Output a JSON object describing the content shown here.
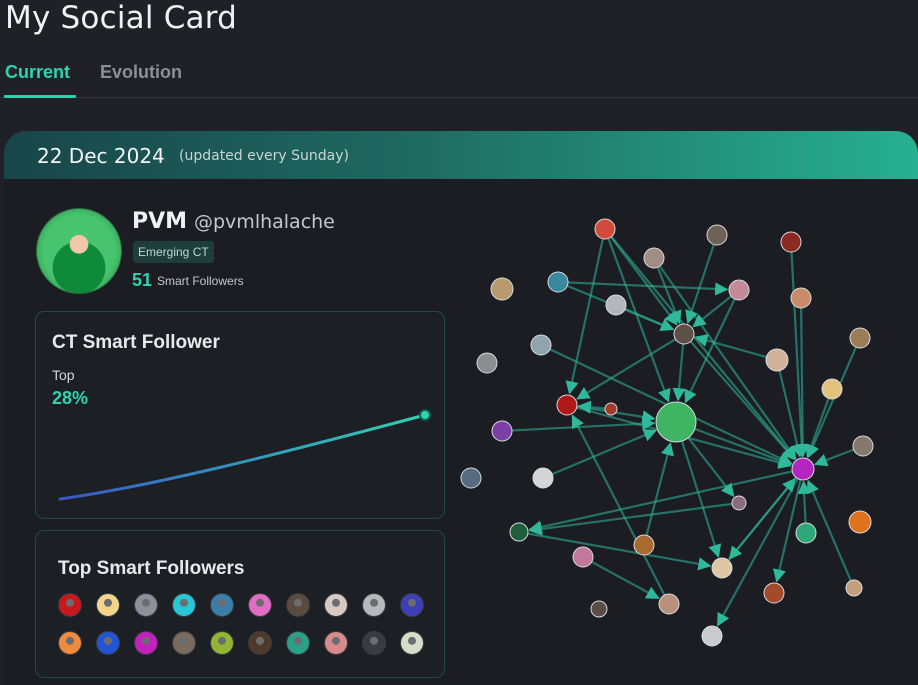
{
  "page": {
    "title": "My Social Card"
  },
  "tabs": [
    {
      "label": "Current",
      "active": true
    },
    {
      "label": "Evolution",
      "active": false
    }
  ],
  "card": {
    "date": "22 Dec 2024",
    "update_note": "(updated every Sunday)",
    "header_gradient": [
      "#18454a",
      "#27b091"
    ]
  },
  "profile": {
    "name": "PVM",
    "handle": "@pvmlhalache",
    "badge": "Emerging CT",
    "smart_followers_count": "51",
    "smart_followers_label": "Smart Followers"
  },
  "ct_panel": {
    "title": "CT Smart Follower",
    "top_label": "Top",
    "top_value": "28%",
    "trend_start_color": "#3a55c8",
    "trend_end_color": "#2fd3b0"
  },
  "top_followers": {
    "title": "Top Smart Followers",
    "avatars": [
      {
        "icon": "red-eye-avatar-icon",
        "color": "#c8181c"
      },
      {
        "icon": "blonde-avatar-icon",
        "color": "#f3d58a"
      },
      {
        "icon": "portrait-avatar-icon",
        "color": "#8d9098"
      },
      {
        "icon": "cyan-face-avatar-icon",
        "color": "#28c7d6"
      },
      {
        "icon": "blue-creature-avatar-icon",
        "color": "#3a7fa8"
      },
      {
        "icon": "pink-character-avatar-icon",
        "color": "#e26bc3"
      },
      {
        "icon": "dark-portrait-avatar-icon",
        "color": "#5b4a3e"
      },
      {
        "icon": "pale-face-avatar-icon",
        "color": "#d9c9c3"
      },
      {
        "icon": "grayscale-man-avatar-icon",
        "color": "#b7b9bc"
      },
      {
        "icon": "neon-avatar-icon",
        "color": "#3d3fb8"
      },
      {
        "icon": "orange-avatar-icon",
        "color": "#f08a3d"
      },
      {
        "icon": "blue-pixel-avatar-icon",
        "color": "#2254d6"
      },
      {
        "icon": "magenta-avatar-icon",
        "color": "#c51fc1"
      },
      {
        "icon": "bearded-man-avatar-icon",
        "color": "#7b6a5e"
      },
      {
        "icon": "green-alien-avatar-icon",
        "color": "#93b534"
      },
      {
        "icon": "dark-beard-avatar-icon",
        "color": "#4f3a2c"
      },
      {
        "icon": "teal-robot-avatar-icon",
        "color": "#2ba089"
      },
      {
        "icon": "pink-skull-avatar-icon",
        "color": "#d98a8a"
      },
      {
        "icon": "shadow-figure-avatar-icon",
        "color": "#383b44"
      },
      {
        "icon": "striped-avatar-icon",
        "color": "#d8dccb"
      }
    ]
  },
  "graph": {
    "nodes": [
      {
        "name": "graph-node-red-hat",
        "color": "#d24a3c"
      },
      {
        "name": "graph-node-portrait-a",
        "color": "#a08d84"
      },
      {
        "name": "graph-node-dark-man",
        "color": "#6e6258"
      },
      {
        "name": "graph-node-red-mask",
        "color": "#8b2a22"
      },
      {
        "name": "graph-node-tan-circle",
        "color": "#b89a6e"
      },
      {
        "name": "graph-node-blue-bear",
        "color": "#3a88a0"
      },
      {
        "name": "graph-node-light-man",
        "color": "#b3b6ba"
      },
      {
        "name": "graph-node-pink-hat",
        "color": "#c48a98"
      },
      {
        "name": "graph-node-orange-creature",
        "color": "#c98b6a"
      },
      {
        "name": "graph-node-brown-face",
        "color": "#9e7c58"
      },
      {
        "name": "graph-node-glasses",
        "color": "#8fa4ae"
      },
      {
        "name": "graph-node-beard-center",
        "color": "#5e5045"
      },
      {
        "name": "graph-node-bald-man",
        "color": "#d2b29b"
      },
      {
        "name": "graph-node-gray-man",
        "color": "#8b8d90"
      },
      {
        "name": "graph-node-yellow-face",
        "color": "#e3c27c"
      },
      {
        "name": "graph-node-red-eye",
        "color": "#b01818"
      },
      {
        "name": "graph-node-pvm-center",
        "color": "#3fb563"
      },
      {
        "name": "graph-node-purple-skull",
        "color": "#7b3fa6"
      },
      {
        "name": "graph-node-dot-red",
        "color": "#a43a28"
      },
      {
        "name": "graph-node-magenta",
        "color": "#b426c0"
      },
      {
        "name": "graph-node-slate",
        "color": "#556b7f"
      },
      {
        "name": "graph-node-black-hat",
        "color": "#d5d5d5"
      },
      {
        "name": "graph-node-small-pixel",
        "color": "#8a6a7c"
      },
      {
        "name": "graph-node-green-circle",
        "color": "#1f5e3a"
      },
      {
        "name": "graph-node-orange-sun",
        "color": "#e0721e"
      },
      {
        "name": "graph-node-pink-pig",
        "color": "#c2779d"
      },
      {
        "name": "graph-node-cat-face",
        "color": "#e0c7a4"
      },
      {
        "name": "graph-node-brunette",
        "color": "#a96a2f"
      },
      {
        "name": "graph-node-owl",
        "color": "#b8917d"
      },
      {
        "name": "graph-node-dark-small",
        "color": "#5a4d44"
      },
      {
        "name": "graph-node-sunglass",
        "color": "#85796d"
      },
      {
        "name": "graph-node-fox",
        "color": "#a34a2c"
      },
      {
        "name": "graph-node-bw-man",
        "color": "#c9cbcf"
      },
      {
        "name": "graph-node-teal-frog",
        "color": "#2fa878"
      },
      {
        "name": "graph-node-brown-dog",
        "color": "#c59f7c"
      }
    ],
    "edge_color": "#2fb89a"
  }
}
